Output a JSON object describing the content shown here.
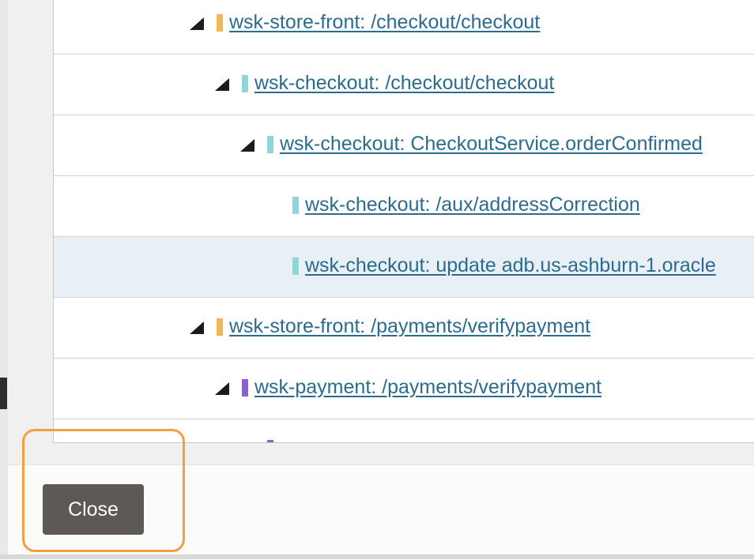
{
  "tree": {
    "rows": [
      {
        "label": "wsk-store-front: /checkout/checkout",
        "color": "#f2b65a",
        "toggle": true
      },
      {
        "label": "wsk-checkout: /checkout/checkout",
        "color": "#8fd6d8",
        "toggle": true
      },
      {
        "label": "wsk-checkout: CheckoutService.orderConfirmed",
        "color": "#8fd6d8",
        "toggle": true
      },
      {
        "label": "wsk-checkout: /aux/addressCorrection",
        "color": "#8fd6d8",
        "toggle": false
      },
      {
        "label": "wsk-checkout: update adb.us-ashburn-1.oracle",
        "color": "#8fd6d8",
        "toggle": false,
        "selected": true
      },
      {
        "label": "wsk-store-front: /payments/verifypayment",
        "color": "#f2b65a",
        "toggle": true
      },
      {
        "label": "wsk-payment: /payments/verifypayment",
        "color": "#8a62c9",
        "toggle": true
      },
      {
        "label": "",
        "color": "#8a62c9",
        "toggle": false
      }
    ]
  },
  "footer": {
    "close_label": "Close"
  }
}
